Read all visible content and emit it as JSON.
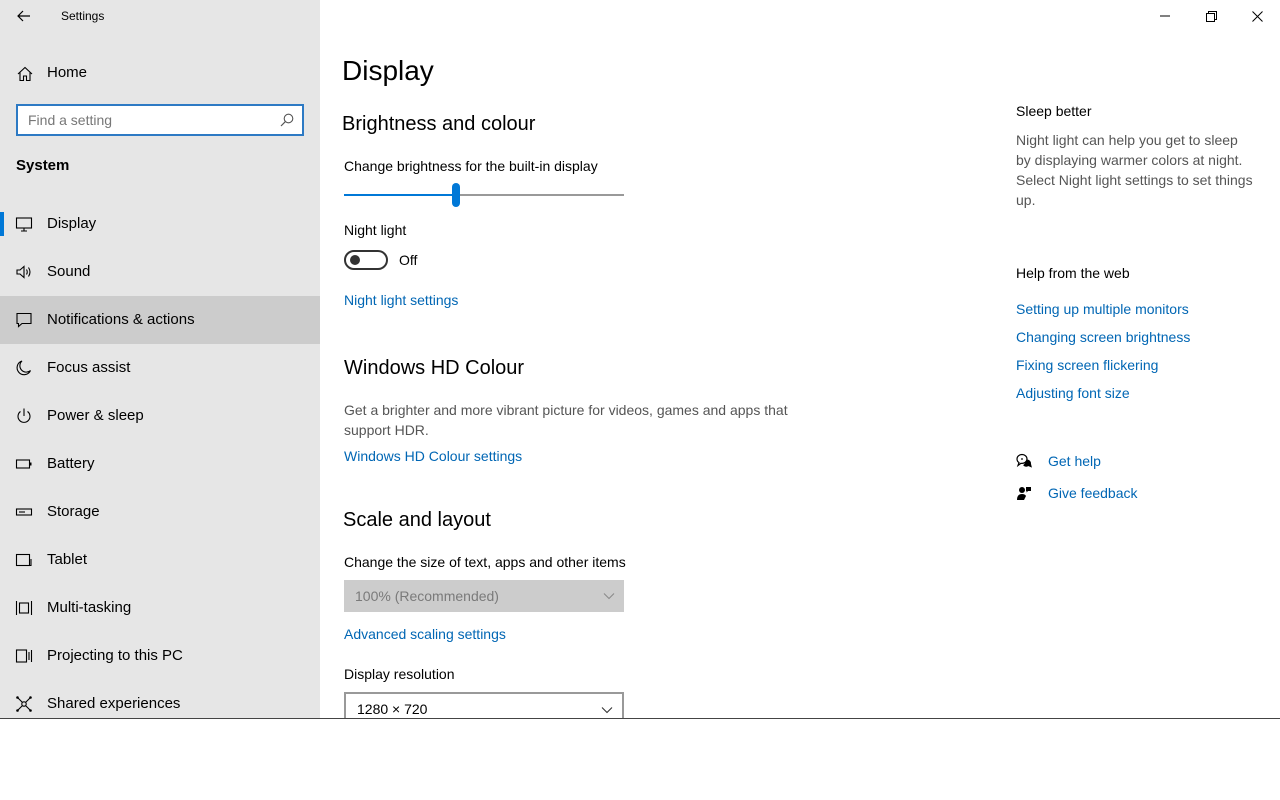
{
  "window": {
    "title": "Settings"
  },
  "sidebar": {
    "home_label": "Home",
    "search_placeholder": "Find a setting",
    "section_title": "System",
    "items": [
      {
        "label": "Display",
        "icon": "monitor-icon"
      },
      {
        "label": "Sound",
        "icon": "speaker-icon"
      },
      {
        "label": "Notifications & actions",
        "icon": "notification-icon"
      },
      {
        "label": "Focus assist",
        "icon": "moon-icon"
      },
      {
        "label": "Power & sleep",
        "icon": "power-icon"
      },
      {
        "label": "Battery",
        "icon": "battery-icon"
      },
      {
        "label": "Storage",
        "icon": "storage-icon"
      },
      {
        "label": "Tablet",
        "icon": "tablet-icon"
      },
      {
        "label": "Multi-tasking",
        "icon": "multitasking-icon"
      },
      {
        "label": "Projecting to this PC",
        "icon": "projecting-icon"
      },
      {
        "label": "Shared experiences",
        "icon": "shared-icon"
      }
    ],
    "selected_index": 0,
    "hover_index": 2
  },
  "main": {
    "page_title": "Display",
    "brightness": {
      "heading": "Brightness and colour",
      "slider_label": "Change brightness for the built-in display",
      "slider_value_percent": 40
    },
    "night_light": {
      "label": "Night light",
      "state_label": "Off",
      "settings_link": "Night light settings"
    },
    "hdr": {
      "heading": "Windows HD Colour",
      "description": "Get a brighter and more vibrant picture for videos, games and apps that support HDR.",
      "settings_link": "Windows HD Colour settings"
    },
    "scale": {
      "heading": "Scale and layout",
      "label": "Change the size of text, apps and other items",
      "selected": "100% (Recommended)",
      "advanced_link": "Advanced scaling settings"
    },
    "resolution": {
      "label": "Display resolution",
      "selected": "1280 × 720"
    }
  },
  "rail": {
    "sleep_heading": "Sleep better",
    "sleep_description": "Night light can help you get to sleep by displaying warmer colors at night. Select Night light settings to set things up.",
    "web_heading": "Help from the web",
    "web_links": [
      "Setting up multiple monitors",
      "Changing screen brightness",
      "Fixing screen flickering",
      "Adjusting font size"
    ],
    "get_help": "Get help",
    "give_feedback": "Give feedback"
  },
  "colors": {
    "accent": "#0078d7",
    "link": "#0066b4",
    "sidebar_bg": "#e6e6e6",
    "hover_bg": "#cccccc"
  }
}
